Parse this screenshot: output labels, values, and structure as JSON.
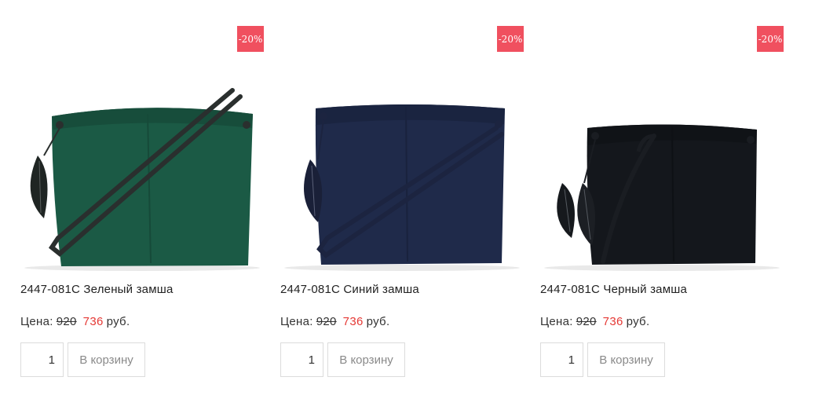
{
  "products": [
    {
      "discount_badge": "-20%",
      "title": "2447-081C Зеленый замша",
      "price_label": "Цена:",
      "old_price": "920",
      "new_price": "736",
      "currency": "руб.",
      "quantity": "1",
      "add_to_cart_label": "В корзину",
      "bag_color": "#1b5a45",
      "strap_color": "#2a2f2e"
    },
    {
      "discount_badge": "-20%",
      "title": "2447-081C Синий замша",
      "price_label": "Цена:",
      "old_price": "920",
      "new_price": "736",
      "currency": "руб.",
      "quantity": "1",
      "add_to_cart_label": "В корзину",
      "bag_color": "#1f2a4a",
      "strap_color": "#1c2440"
    },
    {
      "discount_badge": "-20%",
      "title": "2447-081C Черный замша",
      "price_label": "Цена:",
      "old_price": "920",
      "new_price": "736",
      "currency": "руб.",
      "quantity": "1",
      "add_to_cart_label": "В корзину",
      "bag_color": "#14171c",
      "strap_color": "#1a1d22"
    }
  ],
  "colors": {
    "badge": "#f0505f",
    "new_price": "#e53935"
  }
}
